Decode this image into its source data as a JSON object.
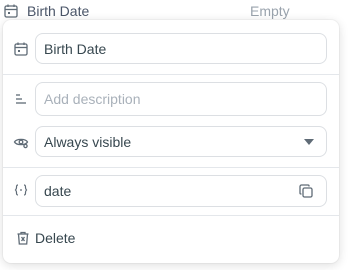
{
  "property_row": {
    "label": "Birth Date",
    "value": "Empty",
    "icon": "calendar-icon"
  },
  "editor": {
    "name_field": {
      "value": "Birth Date",
      "icon": "calendar-icon"
    },
    "description_field": {
      "value": "",
      "placeholder": "Add description",
      "icon": "description-lines-icon"
    },
    "visibility_select": {
      "selected": "Always visible",
      "icon": "eye-settings-icon"
    },
    "key_field": {
      "value": "date",
      "icon": "variable-braces-icon",
      "copy_icon": "copy-icon"
    },
    "delete": {
      "label": "Delete",
      "icon": "trash-icon"
    }
  }
}
